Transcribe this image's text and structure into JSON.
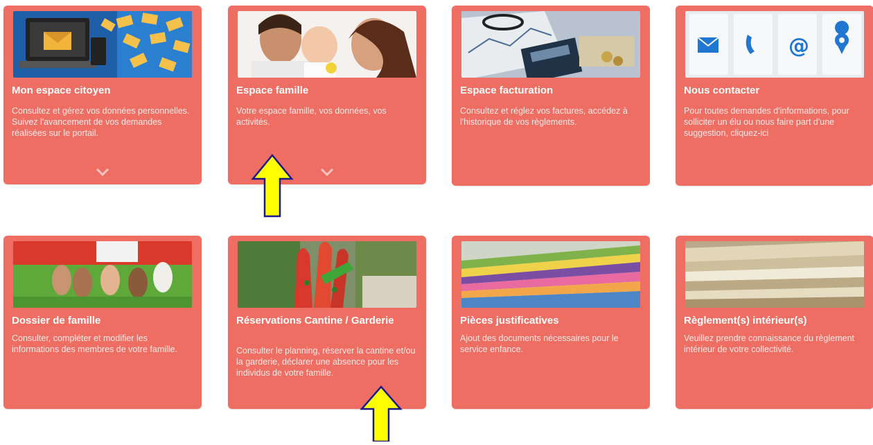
{
  "theme": {
    "card_color": "#ee6e64",
    "arrow_fill": "#ffff00",
    "arrow_stroke": "#1a1a8c"
  },
  "cards": [
    {
      "title": "Mon espace citoyen",
      "description": "Consultez et gérez vos données personnelles. Suivez l'avancement de vos demandes réalisées sur le portail.",
      "image": "envelopes-laptop-image",
      "expandable": true
    },
    {
      "title": "Espace famille",
      "description": "Votre espace famille, vos données, vos activités.",
      "image": "family-photo-image",
      "expandable": true
    },
    {
      "title": "Espace facturation",
      "description": "Consultez et réglez vos factures, accédez à l'historique de vos règlements.",
      "image": "invoices-calculator-image",
      "expandable": false
    },
    {
      "title": "Nous contacter",
      "description": "Pour toutes demandes d'informations, pour solliciter un élu ou nous faire part d'une suggestion, cliquez-ici",
      "image": "contact-icons-image",
      "expandable": false
    },
    {
      "title": "Dossier de famille",
      "description": "Consulter, compléter et modifier les informations des membres de votre famille.",
      "image": "children-feet-grass-image",
      "expandable": false
    },
    {
      "title": "Réservations Cantine / Garderie",
      "description": "Consulter le planning, réserver la cantine et/ou la garderie, déclarer une absence pour les individus de votre famille.",
      "image": "painted-hands-image",
      "expandable": false
    },
    {
      "title": "Pièces justificatives",
      "description": "Ajout des documents nécessaires pour le service enfance.",
      "image": "colored-folders-image",
      "expandable": false
    },
    {
      "title": "Règlement(s) intérieur(s)",
      "description": "Veuillez prendre connaissance du règlement intérieur de votre collectivité.",
      "image": "paper-stack-image",
      "expandable": false
    }
  ],
  "annotations": [
    {
      "name": "yellow-arrow-up-icon",
      "points_to": "Espace famille"
    },
    {
      "name": "yellow-arrow-up-icon",
      "points_to": "Réservations Cantine / Garderie"
    }
  ]
}
